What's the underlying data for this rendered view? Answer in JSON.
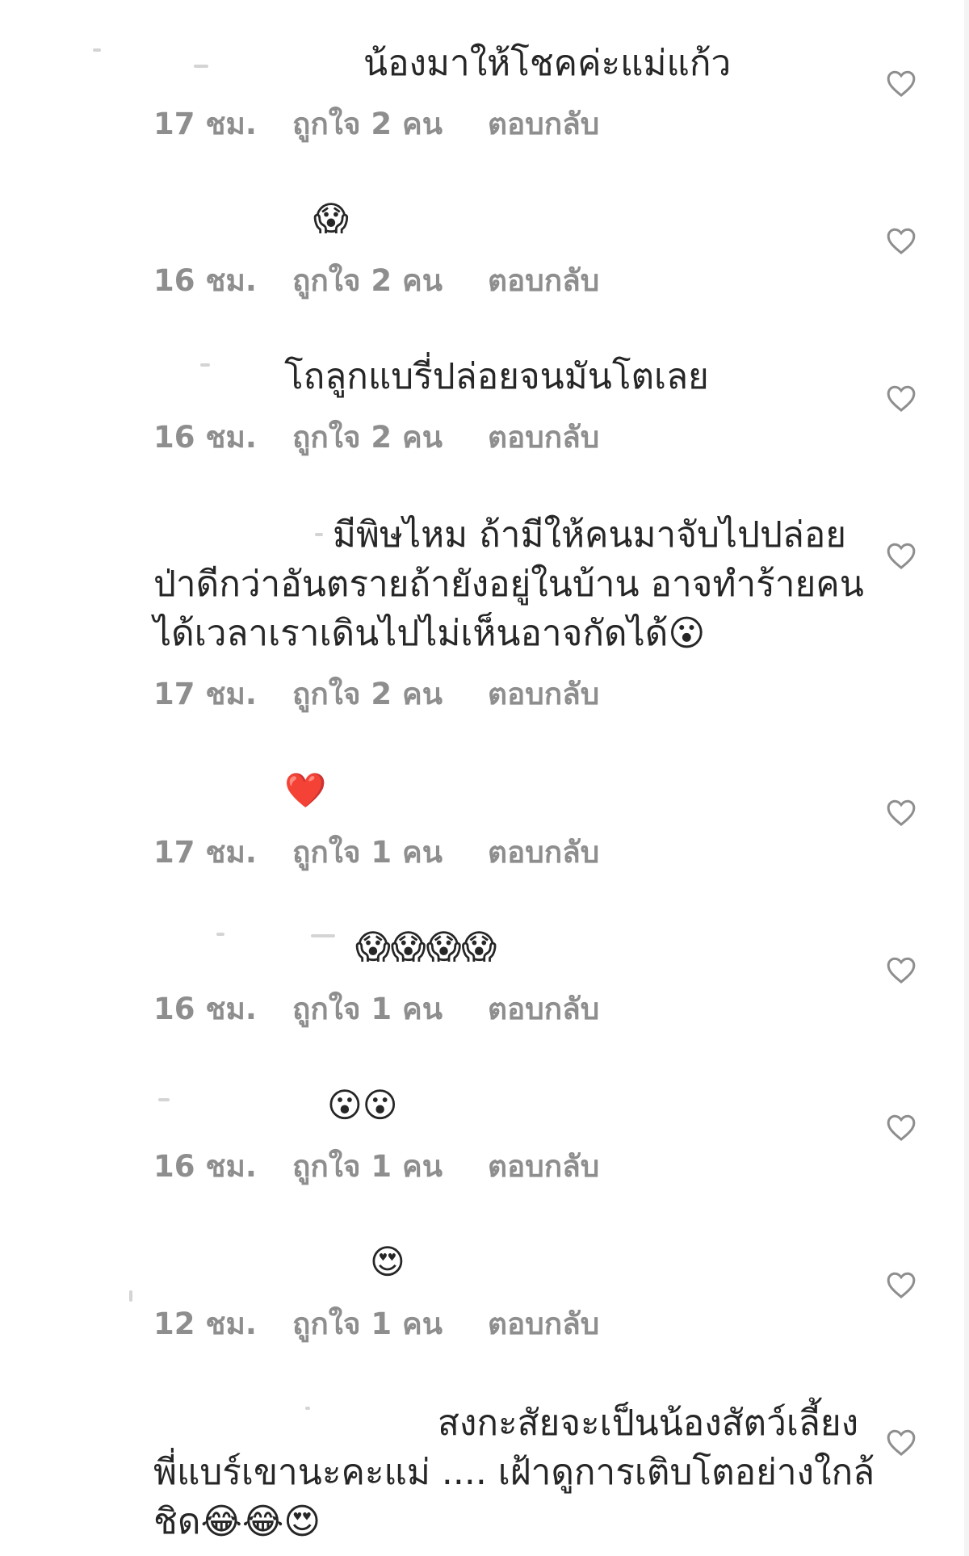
{
  "comments": [
    {
      "lines": [
        "น้องมาให้โชคค่ะแม่แก้ว"
      ],
      "time": "17 ชม.",
      "likes": "ถูกใจ 2 คน",
      "reply": "ตอบกลับ"
    },
    {
      "lines": [
        "😱"
      ],
      "time": "16 ชม.",
      "likes": "ถูกใจ 2 คน",
      "reply": "ตอบกลับ"
    },
    {
      "lines": [
        "โถลูกแบรี่ปล่อยจนมันโตเลย"
      ],
      "time": "16 ชม.",
      "likes": "ถูกใจ 2 คน",
      "reply": "ตอบกลับ"
    },
    {
      "lines": [
        "มีพิษไหม ถ้ามีให้คนมาจับไปปล่อย",
        "ป่าดีกว่าอันตรายถ้ายังอยู่ในบ้าน อาจทำร้ายคน",
        "ได้เวลาเราเดินไปไม่เห็นอาจกัดได้😮"
      ],
      "time": "17 ชม.",
      "likes": "ถูกใจ 2 คน",
      "reply": "ตอบกลับ"
    },
    {
      "lines": [
        "❤️"
      ],
      "time": "17 ชม.",
      "likes": "ถูกใจ 1 คน",
      "reply": "ตอบกลับ"
    },
    {
      "lines": [
        "😱😱😱😱"
      ],
      "time": "16 ชม.",
      "likes": "ถูกใจ 1 คน",
      "reply": "ตอบกลับ"
    },
    {
      "lines": [
        "😮😮"
      ],
      "time": "16 ชม.",
      "likes": "ถูกใจ 1 คน",
      "reply": "ตอบกลับ"
    },
    {
      "lines": [
        "😍"
      ],
      "time": "12 ชม.",
      "likes": "ถูกใจ 1 คน",
      "reply": "ตอบกลับ"
    },
    {
      "lines": [
        "สงกะสัยจะเป็นน้องสัตว์เลี้ยง",
        "พี่แบร์เขานะคะแม่ .... เฝ้าดูการเติบโตอย่างใกล้",
        "ชิด😂😂😍"
      ],
      "time": "",
      "likes": "",
      "reply": ""
    }
  ],
  "icons": {
    "like": "heart-outline-icon"
  },
  "colors": {
    "text": "#262626",
    "meta": "#8e8e8e",
    "heart": "#8e8e8e"
  }
}
